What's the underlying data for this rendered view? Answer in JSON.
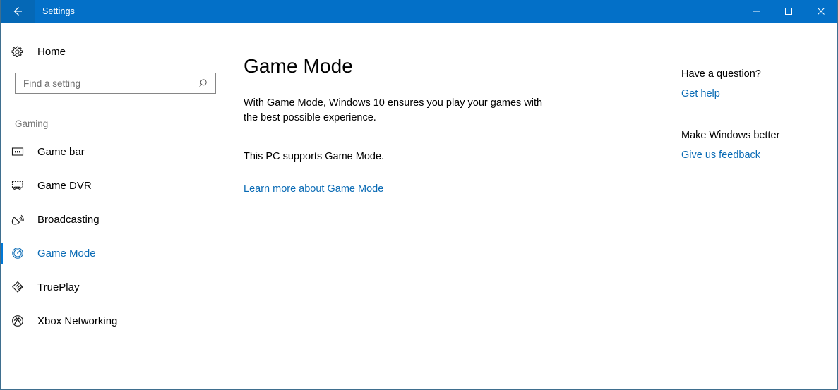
{
  "titlebar": {
    "back_icon": "back-arrow-icon",
    "title": "Settings",
    "minimize_icon": "minimize-icon",
    "maximize_icon": "maximize-icon",
    "close_icon": "close-icon",
    "background_color": "#0370c8"
  },
  "sidebar": {
    "home": {
      "label": "Home",
      "icon": "gear-icon"
    },
    "search": {
      "placeholder": "Find a setting",
      "value": "",
      "icon": "search-icon"
    },
    "group_header": "Gaming",
    "selected_accent_color": "#0078d7",
    "selected_text_color": "#0a6bb5",
    "items": [
      {
        "label": "Game bar",
        "icon": "game-bar-icon",
        "selected": false
      },
      {
        "label": "Game DVR",
        "icon": "game-dvr-icon",
        "selected": false
      },
      {
        "label": "Broadcasting",
        "icon": "broadcast-dish-icon",
        "selected": false
      },
      {
        "label": "Game Mode",
        "icon": "gauge-icon",
        "selected": true
      },
      {
        "label": "TruePlay",
        "icon": "shield-icon",
        "selected": false
      },
      {
        "label": "Xbox Networking",
        "icon": "xbox-icon",
        "selected": false
      }
    ]
  },
  "main": {
    "title": "Game Mode",
    "description": "With Game Mode, Windows 10 ensures you play your games with the best possible experience.",
    "support_text": "This PC supports Game Mode.",
    "learn_more_link": "Learn more about Game Mode",
    "link_color": "#0a6bb5"
  },
  "rail": {
    "question_heading": "Have a question?",
    "get_help_link": "Get help",
    "feedback_heading": "Make Windows better",
    "feedback_link": "Give us feedback"
  }
}
